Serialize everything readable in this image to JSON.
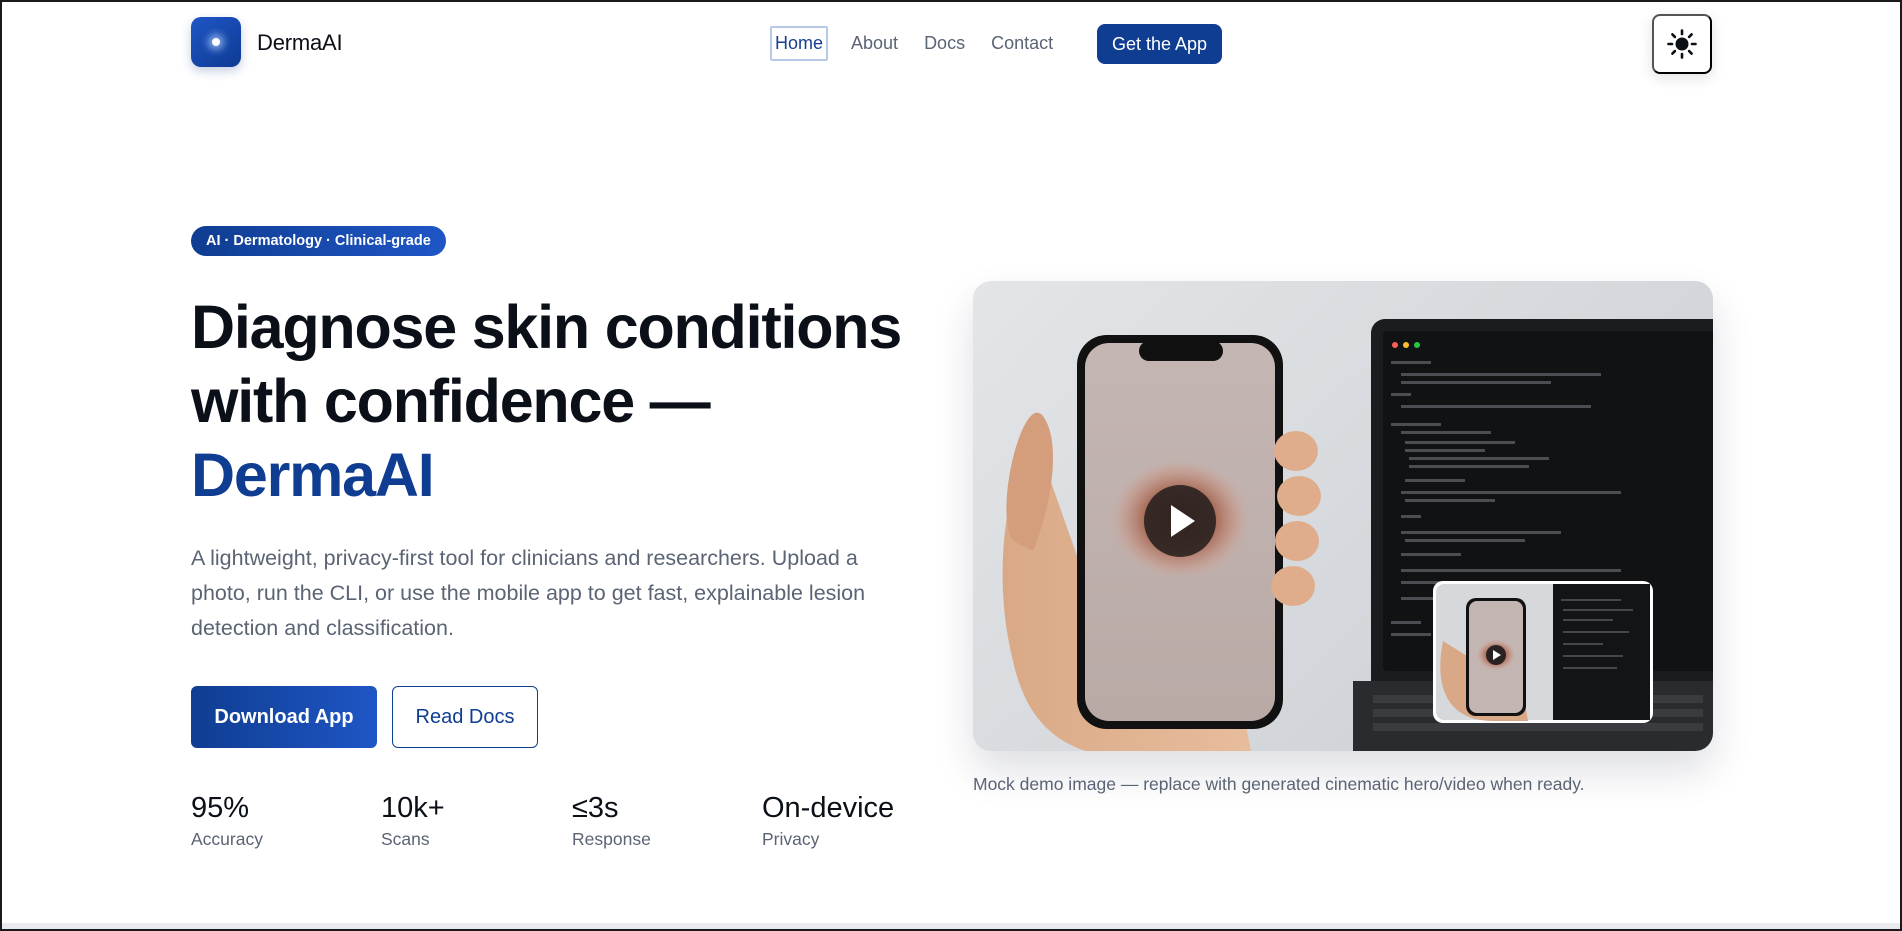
{
  "brand": {
    "name": "DermaAI"
  },
  "nav": {
    "links": [
      "Home",
      "About",
      "Docs",
      "Contact"
    ],
    "active": "Home",
    "cta": "Get the App",
    "theme_icon": "sun-icon"
  },
  "hero": {
    "badge": "AI · Dermatology · Clinical-grade",
    "title_line1": "Diagnose skin conditions",
    "title_line2": "with confidence —",
    "title_accent": "DermaAI",
    "lede": "A lightweight, privacy-first tool for clinicians and researchers. Upload a photo, run the CLI, or use the mobile app to get fast, explainable lesion detection and classification.",
    "primary_button": "Download App",
    "secondary_button": "Read Docs",
    "stats": [
      {
        "value": "95%",
        "label": "Accuracy"
      },
      {
        "value": "10k+",
        "label": "Scans"
      },
      {
        "value": "≤3s",
        "label": "Response"
      },
      {
        "value": "On-device",
        "label": "Privacy"
      }
    ],
    "media_caption": "Mock demo image — replace with generated cinematic hero/video when ready.",
    "media_icons": [
      "play-icon"
    ]
  },
  "colors": {
    "brand": "#0f3d91",
    "brand_light": "#1f56c6",
    "text": "#0b0f17",
    "muted": "#5b6474"
  }
}
